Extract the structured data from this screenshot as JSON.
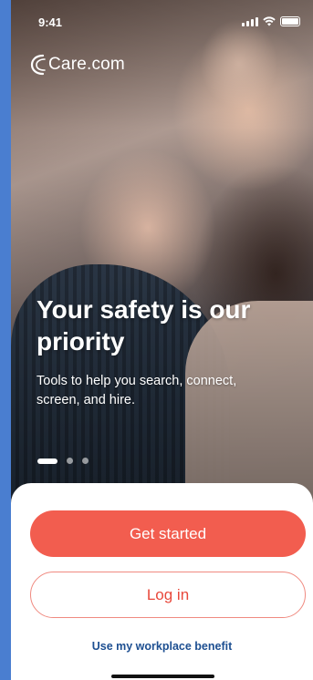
{
  "status_bar": {
    "time": "9:41"
  },
  "brand": {
    "name": "Care.com"
  },
  "hero": {
    "headline": "Your safety is our priority",
    "subtext": "Tools to help you search, connect, screen, and hire."
  },
  "carousel": {
    "count": 3,
    "active_index": 0
  },
  "actions": {
    "get_started": "Get started",
    "log_in": "Log in",
    "workplace_benefit": "Use my workplace benefit"
  },
  "colors": {
    "primary": "#f25d4f",
    "primary_text_on_white": "#e8483b",
    "link": "#1d4f91",
    "outer_background": "#4a7ed0"
  },
  "icons": {
    "signal": "cellular-signal-icon",
    "wifi": "wifi-icon",
    "battery": "battery-icon",
    "logo_mark": "care-logo-mark-icon"
  }
}
